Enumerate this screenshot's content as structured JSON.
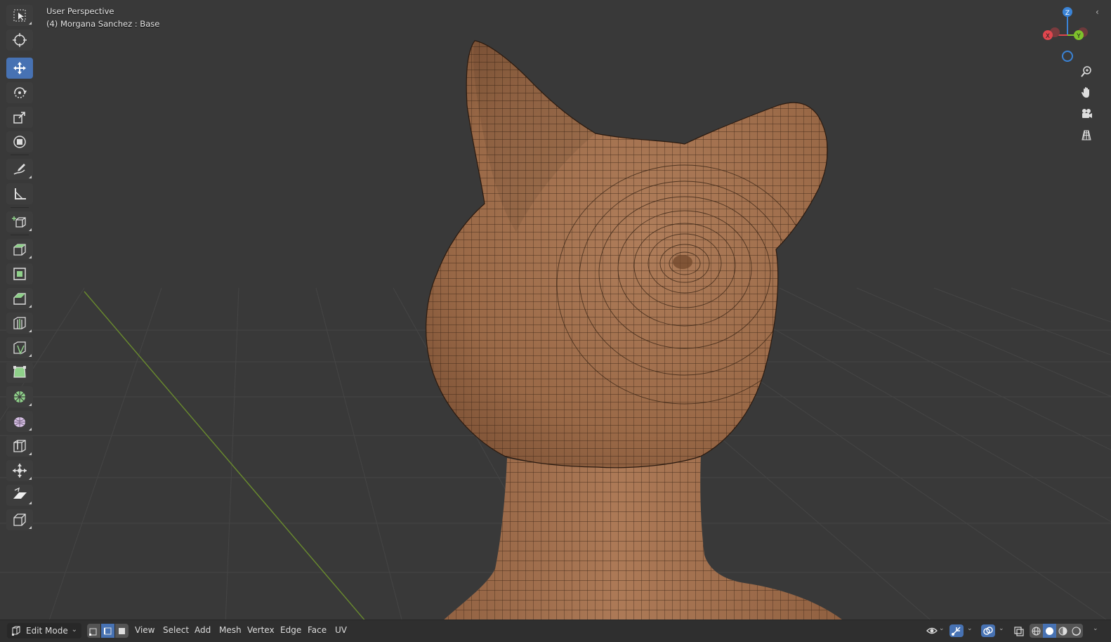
{
  "viewport": {
    "view_name": "User Perspective",
    "object_info": "(4) Morgana Sanchez : Base",
    "background_color": "#393939",
    "grid_color": "#464646",
    "y_axis_color": "#6a8c2e",
    "mesh_color": "#a5724f",
    "wire_color": "#2a1a10"
  },
  "toolbar": {
    "tools": [
      {
        "name": "select-box",
        "icon": "select-box-icon"
      },
      {
        "name": "cursor",
        "icon": "cursor-icon"
      },
      {
        "name": "move",
        "icon": "move-icon",
        "active": true
      },
      {
        "name": "rotate",
        "icon": "rotate-icon"
      },
      {
        "name": "scale",
        "icon": "scale-icon"
      },
      {
        "name": "transform",
        "icon": "transform-icon"
      },
      {
        "name": "annotate",
        "icon": "annotate-icon"
      },
      {
        "name": "measure",
        "icon": "measure-icon"
      },
      {
        "name": "add-cube",
        "icon": "add-cube-icon"
      },
      {
        "name": "extrude-region",
        "icon": "extrude-icon"
      },
      {
        "name": "inset-faces",
        "icon": "inset-icon"
      },
      {
        "name": "bevel",
        "icon": "bevel-icon"
      },
      {
        "name": "loop-cut",
        "icon": "loop-cut-icon"
      },
      {
        "name": "knife",
        "icon": "knife-icon"
      },
      {
        "name": "poly-build",
        "icon": "poly-build-icon"
      },
      {
        "name": "spin",
        "icon": "spin-icon"
      },
      {
        "name": "smooth",
        "icon": "smooth-icon"
      },
      {
        "name": "edge-slide",
        "icon": "edge-slide-icon"
      },
      {
        "name": "shrink-fatten",
        "icon": "shrink-fatten-icon"
      },
      {
        "name": "shear",
        "icon": "shear-icon"
      },
      {
        "name": "rip-region",
        "icon": "rip-region-icon"
      }
    ]
  },
  "gizmo": {
    "axes": {
      "x": "X",
      "y": "Y",
      "z": "Z"
    },
    "colors": {
      "x": "#e0464e",
      "y": "#7ec22b",
      "z": "#3a83d6"
    }
  },
  "navigation": [
    "zoom-icon",
    "pan-hand-icon",
    "camera-icon",
    "ortho-grid-icon"
  ],
  "header": {
    "mode": "Edit Mode",
    "menus": [
      "View",
      "Select",
      "Add",
      "Mesh",
      "Vertex",
      "Edge",
      "Face",
      "UV"
    ],
    "select_modes": [
      "vertex-select-icon",
      "edge-select-icon",
      "face-select-icon"
    ],
    "active_select_mode": "edge-select-icon",
    "shading_modes": [
      "wireframe-shading-icon",
      "solid-shading-icon",
      "material-shading-icon",
      "rendered-shading-icon"
    ],
    "active_shading": "solid-shading-icon"
  }
}
